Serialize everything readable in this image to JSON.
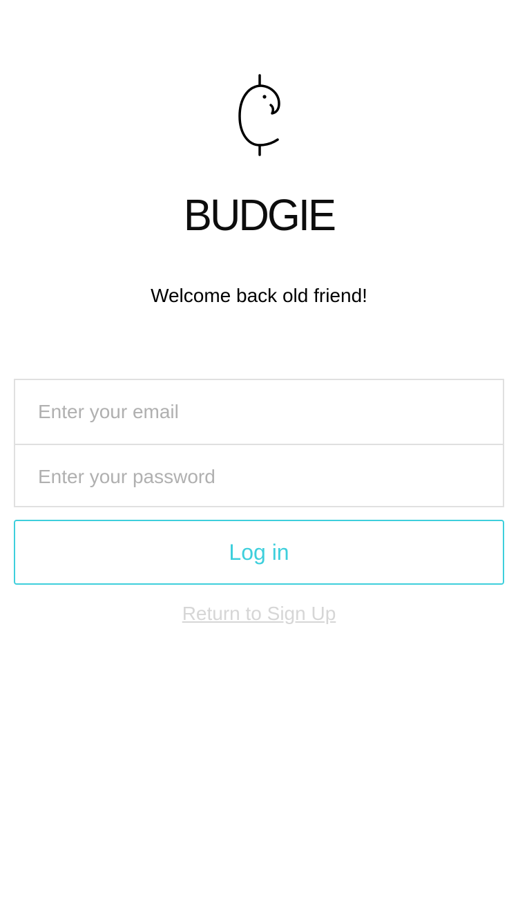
{
  "brand": {
    "logo_icon": "budgie-bird-icon",
    "name": "BUDGIE"
  },
  "welcome_message": "Welcome back old friend!",
  "form": {
    "email_placeholder": "Enter your email",
    "email_value": "",
    "password_placeholder": "Enter your password",
    "password_value": ""
  },
  "login_button_label": "Log in",
  "return_link_label": "Return to Sign Up",
  "colors": {
    "accent": "#3ecfdc",
    "border": "#e0e0e0",
    "placeholder": "#b0b0b0",
    "link": "#d6d6d6"
  }
}
